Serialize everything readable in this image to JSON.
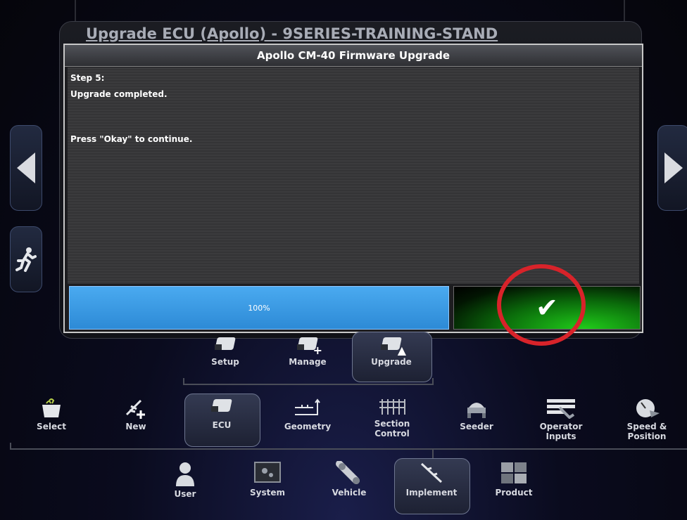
{
  "background": {
    "title": "Upgrade ECU (Apollo) - 9SERIES-TRAINING-STAND"
  },
  "dialog": {
    "title": "Apollo CM-40 Firmware Upgrade",
    "step": "Step 5:",
    "status": "Upgrade completed.",
    "instruction": "Press \"Okay\" to continue.",
    "progress_label": "100%",
    "progress_value": 1.0,
    "okay_icon": "checkmark-icon"
  },
  "ecu_menu": {
    "items": [
      {
        "label": "Setup",
        "icon": "ecu-setup-icon"
      },
      {
        "label": "Manage",
        "icon": "ecu-manage-icon"
      },
      {
        "label": "Upgrade",
        "icon": "ecu-upgrade-icon",
        "selected": true
      }
    ]
  },
  "implement_menu": {
    "items": [
      {
        "label": "Select",
        "icon": "basket-icon"
      },
      {
        "label": "New",
        "icon": "new-implement-icon"
      },
      {
        "label": "ECU",
        "icon": "ecu-icon",
        "selected": true
      },
      {
        "label": "Geometry",
        "icon": "geometry-icon"
      },
      {
        "label": "Section Control",
        "icon": "section-control-icon"
      },
      {
        "label": "Seeder",
        "icon": "seeder-icon"
      },
      {
        "label": "Operator Inputs",
        "icon": "operator-inputs-icon"
      },
      {
        "label": "Speed & Position",
        "icon": "speedometer-icon"
      }
    ]
  },
  "main_menu": {
    "items": [
      {
        "label": "User",
        "icon": "user-icon"
      },
      {
        "label": "System",
        "icon": "system-icon"
      },
      {
        "label": "Vehicle",
        "icon": "vehicle-icon"
      },
      {
        "label": "Implement",
        "icon": "implement-icon",
        "selected": true
      },
      {
        "label": "Product",
        "icon": "product-icon"
      }
    ]
  },
  "colors": {
    "progress": "#3a9de6",
    "okay_green": "#1ec41a",
    "highlight_circle": "#d8232a"
  }
}
